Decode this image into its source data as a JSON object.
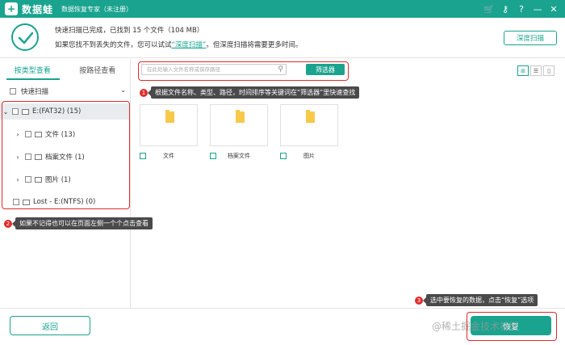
{
  "titlebar": {
    "logo_glyph": "+",
    "app_name": "数据蛙",
    "subtitle": "数据恢复专家（未注册）",
    "icons": [
      "cart-icon",
      "key-icon",
      "help-icon",
      "minimize-icon",
      "close-icon"
    ],
    "icon_glyphs": [
      "🛒",
      "⚷",
      "?",
      "—",
      "✕"
    ]
  },
  "status": {
    "line1": "快速扫描已完成，已找到 15 个文件（104 MB）",
    "line2_prefix": "如果您找不到丢失的文件，您可以试试",
    "line2_link": "“深度扫描”",
    "line2_suffix": "。但深度扫描将需要更多时间。",
    "deep_scan_button": "深度扫描"
  },
  "left": {
    "tabs": [
      {
        "label": "按类型查看",
        "active": true
      },
      {
        "label": "按路径查看",
        "active": false
      }
    ],
    "quick_scan_label": "快速扫描",
    "tree": [
      {
        "label": "E:(FAT32) (15)",
        "arrow": "⌄",
        "selected": true
      },
      {
        "label": "文件 (13)",
        "arrow": "›",
        "selected": false
      },
      {
        "label": "档案文件 (1)",
        "arrow": "›",
        "selected": false
      },
      {
        "label": "图片 (1)",
        "arrow": "›",
        "selected": false
      },
      {
        "label": "Lost - E:(NTFS) (0)",
        "arrow": "",
        "selected": false
      }
    ]
  },
  "right": {
    "search_placeholder": "在此处输入文件名称或保存路径",
    "filter_button": "筛选器",
    "view_icons": [
      "⊞",
      "☰",
      "▯"
    ],
    "files": [
      {
        "name": "文件"
      },
      {
        "name": "档案文件"
      },
      {
        "name": "图片"
      }
    ]
  },
  "footer": {
    "back_button": "返回",
    "recover_button": "恢复",
    "watermark": "@稀土掘金技术社区"
  },
  "annotations": [
    {
      "num": "1",
      "text": "根据文件名称、类型、路径，时间排序等关键词在“筛选器”里快速查找"
    },
    {
      "num": "2",
      "text": "如果不记得也可以在页面左侧一个个点击查看"
    },
    {
      "num": "3",
      "text": "选中要恢复的数据，点击“恢复”选项"
    }
  ],
  "colors": {
    "accent": "#1aa38f",
    "annotation_red": "#e02b2b",
    "folder": "#f6c94a"
  }
}
